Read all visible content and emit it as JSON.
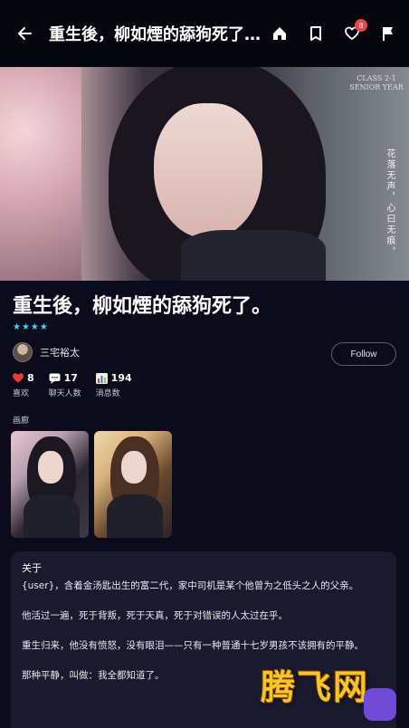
{
  "topbar": {
    "title": "重生後，柳如煙的舔狗死了...",
    "heart_badge": "8"
  },
  "hero": {
    "sign_line1": "CLASS 2-1",
    "sign_line2": "SENIOR YEAR",
    "vertical_text": "花落无声，心曰无痕。"
  },
  "book": {
    "title": "重生後，柳如煙的舔狗死了。",
    "stars": "★★★★",
    "author": "三宅裕太",
    "follow_label": "Follow"
  },
  "stats": [
    {
      "value": "8",
      "label": "喜欢",
      "icon": "heart-icon"
    },
    {
      "value": "17",
      "label": "聊天人数",
      "icon": "chat-icon"
    },
    {
      "value": "194",
      "label": "消息数",
      "icon": "bar-chart-icon"
    }
  ],
  "gallery": {
    "label": "画廊"
  },
  "about": {
    "heading": "关于",
    "paragraphs": [
      "{user}，含着金汤匙出生的富二代，家中司机是某个他曾为之低头之人的父亲。",
      "他活过一遍，死于背叛，死于天真，死于对错误的人太过在乎。",
      "重生归来，他没有愤怒，没有眼泪——只有一种普通十七岁男孩不该拥有的平静。",
      "那种平静，叫做：我全都知道了。"
    ]
  },
  "watermark": "腾飞网",
  "colors": {
    "background": "#0b0b1c",
    "accent": "#4fd0f0",
    "card": "#1a1a2e",
    "badge": "#e54848"
  }
}
